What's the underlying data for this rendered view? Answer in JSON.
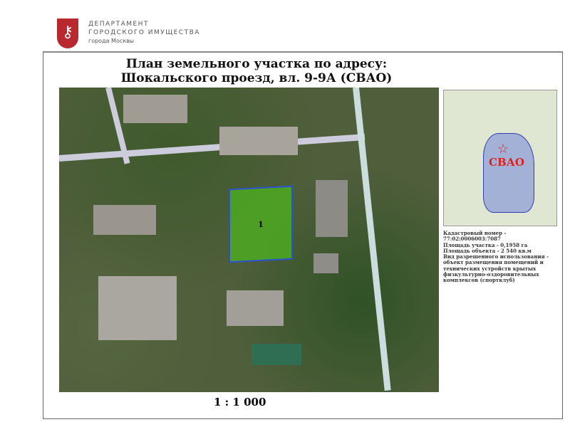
{
  "header": {
    "logo_icon": "keys-emblem-icon",
    "org_line1": "ДЕПАРТАМЕНТ",
    "org_line2": "ГОРОДСКОГО ИМУЩЕСТВА",
    "org_line3": "города Москвы"
  },
  "title": {
    "line1": "План земельного участка по адресу:",
    "line2": "Шокальского проезд, вл. 9-9А (СВАО)"
  },
  "map": {
    "plot_label": "1",
    "plot_color": "#4caf20",
    "plot_border": "#2a4fd0"
  },
  "inset": {
    "label": "СВАО"
  },
  "info": {
    "lines": [
      "Кадастровый номер - 77:02:0006003:7087",
      "Площадь участка - 0,1958 га",
      "Площадь объекта - 2 540 кв.м",
      "Вид разрешенного использования - объект размещения помещений и технических устройств крытых физкультурно-оздоровительных комплексов (спортклуб)"
    ]
  },
  "scale": "1 : 1 000"
}
